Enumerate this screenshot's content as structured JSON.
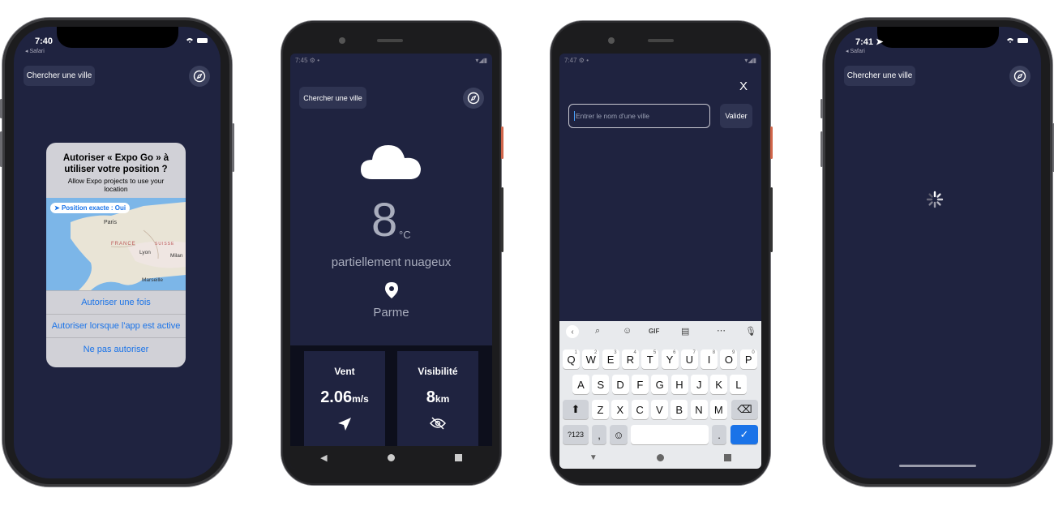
{
  "phone1": {
    "status_time": "7:40",
    "status_back": "◂ Safari",
    "search_label": "Chercher une ville",
    "dialog": {
      "title": "Autoriser « Expo Go » à utiliser votre position ?",
      "message": "Allow Expo projects to use your location",
      "precise_badge": "Position exacte : Oui",
      "map_labels": {
        "paris": "Paris",
        "france": "FRANCE",
        "suisse": "SUISSE",
        "lyon": "Lyon",
        "milan": "Milan",
        "marseille": "Marseille"
      },
      "buttons": [
        "Autoriser une fois",
        "Autoriser lorsque l'app est active",
        "Ne pas autoriser"
      ]
    }
  },
  "phone2": {
    "status_time": "7:45",
    "search_label": "Chercher une ville",
    "temperature": "8",
    "unit": "°C",
    "description": "partiellement nuageux",
    "city": "Parme",
    "cards": [
      {
        "label": "Vent",
        "value": "2.06",
        "unit": "m/s",
        "icon": "navigation-arrow-icon"
      },
      {
        "label": "Visibilité",
        "value": "8",
        "unit": "km",
        "icon": "eye-off-icon"
      }
    ]
  },
  "phone3": {
    "status_time": "7:47",
    "close_label": "X",
    "input_placeholder": "Entrer le nom d'une ville",
    "submit_label": "Valider",
    "keyboard": {
      "row1": [
        "Q",
        "W",
        "E",
        "R",
        "T",
        "Y",
        "U",
        "I",
        "O",
        "P"
      ],
      "row1_hints": [
        "1",
        "2",
        "3",
        "4",
        "5",
        "6",
        "7",
        "8",
        "9",
        "0"
      ],
      "row2": [
        "A",
        "S",
        "D",
        "F",
        "G",
        "H",
        "J",
        "K",
        "L"
      ],
      "row3": [
        "Z",
        "X",
        "C",
        "V",
        "B",
        "N",
        "M"
      ],
      "sym_label": "?123",
      "comma": ",",
      "period": ".",
      "toolbar_gif": "GIF"
    }
  },
  "phone4": {
    "status_time": "7:41",
    "status_back": "◂ Safari",
    "search_label": "Chercher une ville"
  },
  "colors": {
    "app_bg": "#1f2340",
    "button_bg": "#2f3452",
    "ios_blue": "#1a73e8",
    "android_accent": "#1a73e8"
  }
}
